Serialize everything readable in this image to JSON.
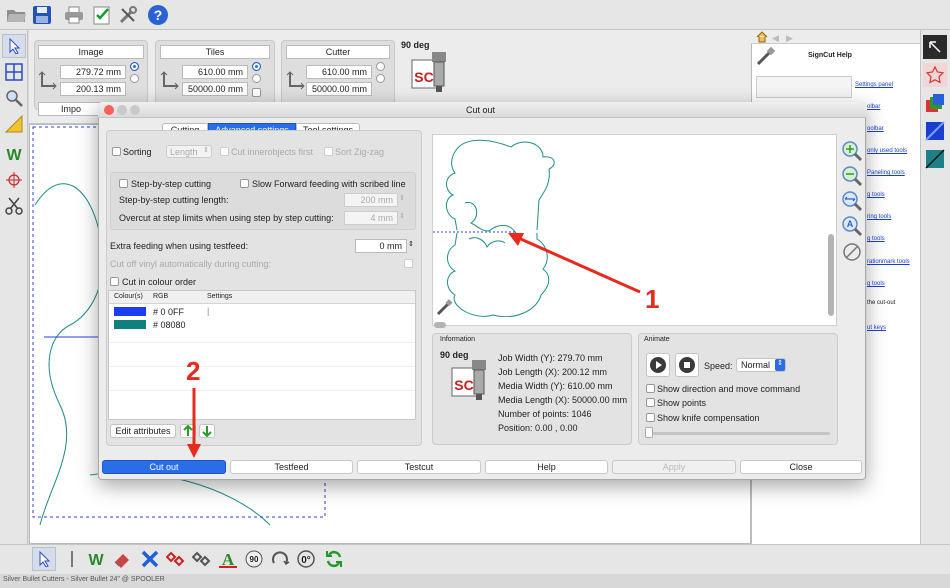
{
  "toolbar": {
    "angle_label": "90 deg"
  },
  "image_panel": {
    "title": "Image",
    "width": "279.72 mm",
    "height": "200.13 mm",
    "import_label": "Impo"
  },
  "tiles_panel": {
    "title": "Tiles",
    "width": "610.00 mm",
    "height": "50000.00 mm"
  },
  "cutter_panel": {
    "title": "Cutter",
    "width": "610.00 mm",
    "height": "50000.00 mm"
  },
  "help_panel": {
    "title": "SignCut Help",
    "links": [
      "Settings panel",
      "olbar",
      "oolbar",
      "only used tools",
      "Paneling tools",
      "g tools",
      "ring tools",
      "g tools",
      "rationmark tools",
      "g tools",
      "the cut-out",
      "ut keys"
    ]
  },
  "dialog": {
    "title": "Cut out",
    "tabs": [
      "Cutting",
      "Advanced settings",
      "Tool settings"
    ],
    "sorting_label": "Sorting",
    "length_select": "Length",
    "cut_inner_label": "Cut innerobjects first",
    "sort_zigzag_label": "Sort Zig-zag",
    "step_by_step_label": "Step-by-step cutting",
    "slow_forward_label": "Slow Forward feeding with scribed line",
    "step_length_label": "Step-by-step cutting length:",
    "step_length_value": "200 mm",
    "overcut_label": "Overcut at step limits when using step by step cutting:",
    "overcut_value": "4 mm",
    "extra_feed_label": "Extra feeding when using testfeed:",
    "extra_feed_value": "0 mm",
    "cut_off_vinyl_label": "Cut off vinyl automatically during cutting:",
    "colour_order_label": "Cut in colour order",
    "table_headers": [
      "Colour(s)",
      "RGB",
      "Settings"
    ],
    "colours": [
      {
        "swatch": "#1b3ff0",
        "rgb": "# 0 0FF",
        "settings": "|"
      },
      {
        "swatch": "#0f8080",
        "rgb": "# 08080",
        "settings": ""
      }
    ],
    "edit_attributes": "Edit attributes",
    "info_title": "Information",
    "info_angle": "90 deg",
    "info_lines": [
      "Job Width (Y): 279.70 mm",
      "Job Length (X): 200.12 mm",
      "Media Width (Y): 610.00 mm",
      "Media Length (X): 50000.00 mm",
      "Number of points: 1046",
      "Position: 0.00 , 0.00"
    ],
    "animate_title": "Animate",
    "speed_label": "Speed:",
    "speed_value": "Normal",
    "show_direction_label": "Show direction and move command",
    "show_points_label": "Show points",
    "show_knife_label": "Show knife compensation",
    "buttons": {
      "cut_out": "Cut out",
      "testfeed": "Testfeed",
      "testcut": "Testcut",
      "help": "Help",
      "apply": "Apply",
      "close": "Close"
    }
  },
  "annotations": {
    "one": "1",
    "two": "2"
  },
  "status_bar": {
    "text": "Silver Bullet Cutters - Silver Bullet 24\" @ SPOOLER"
  },
  "colors": {
    "accent": "#2a6de8",
    "annotation": "#e8291c"
  }
}
